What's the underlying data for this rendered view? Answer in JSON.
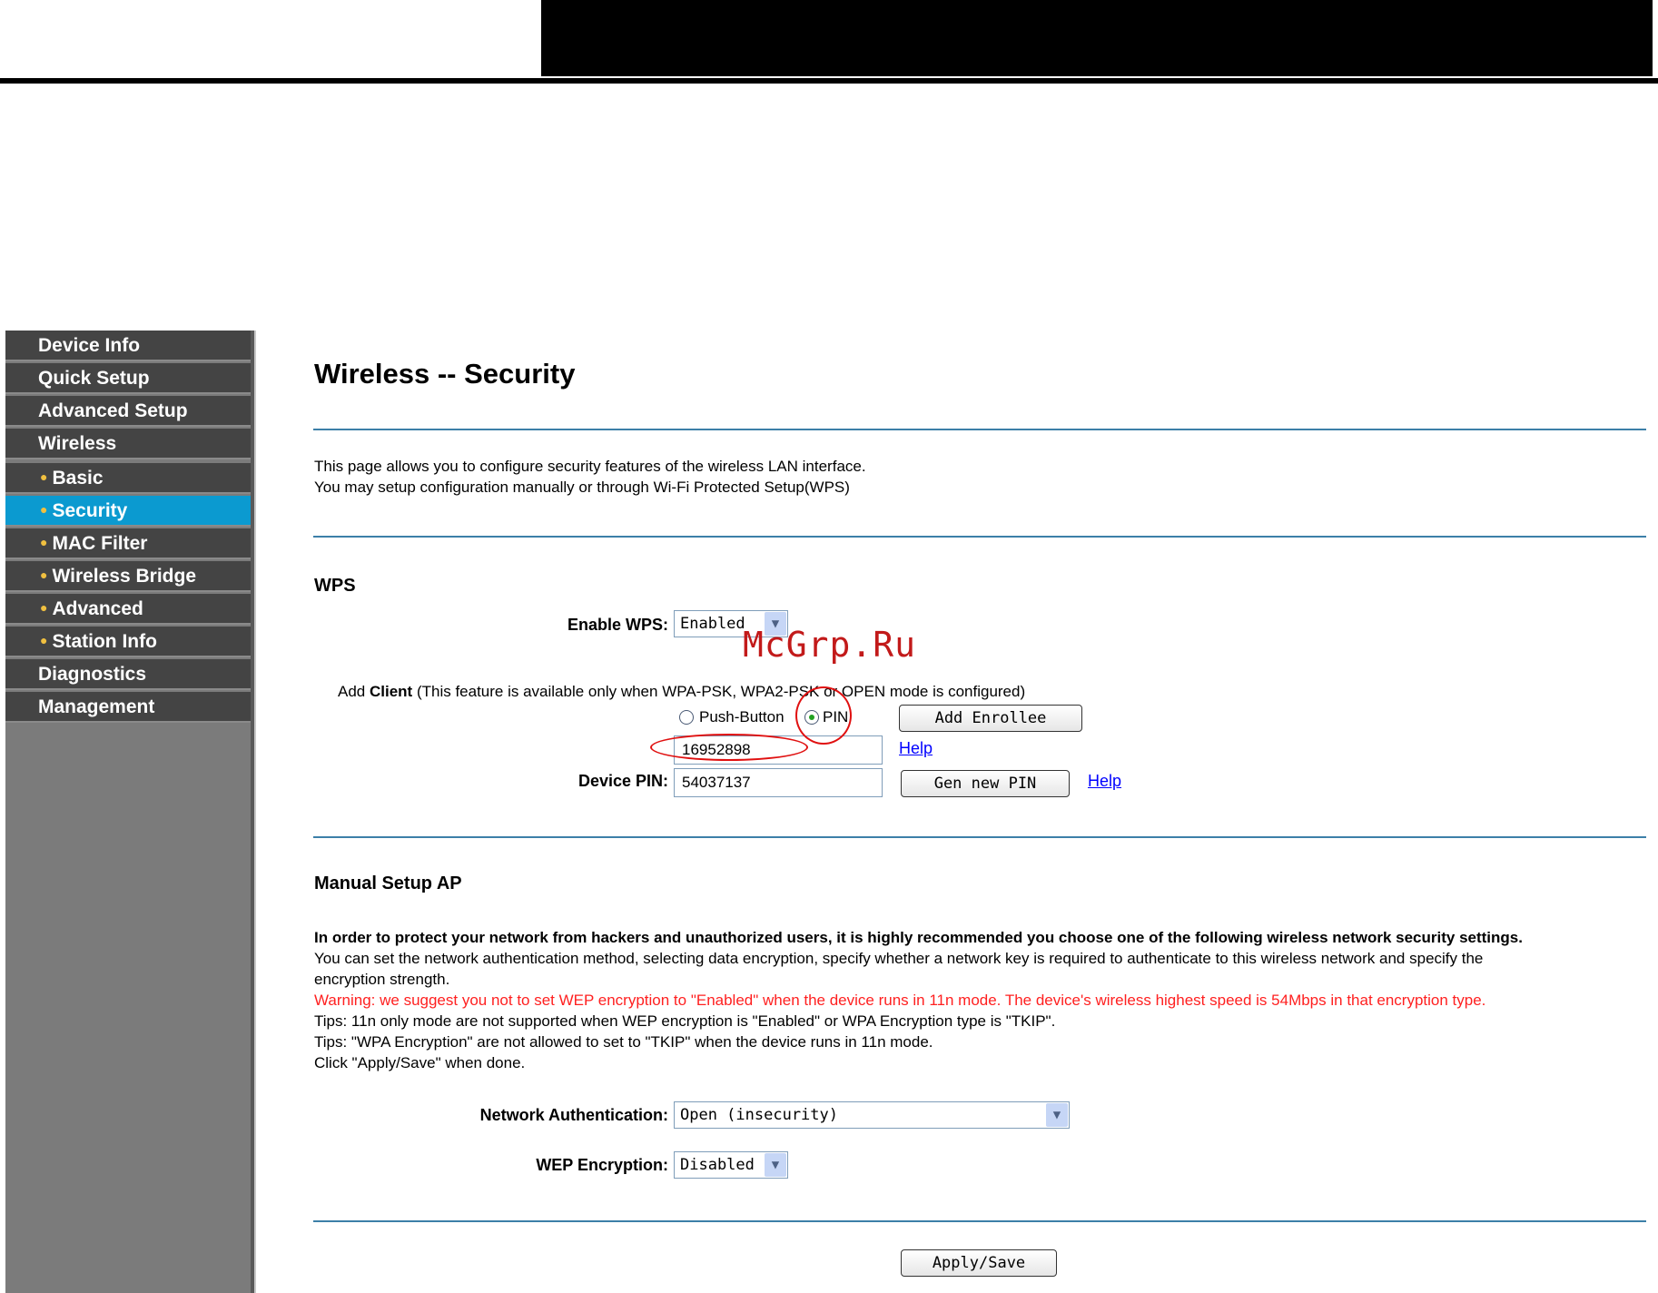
{
  "sidebar": {
    "items": [
      {
        "label": "Device Info"
      },
      {
        "label": "Quick Setup"
      },
      {
        "label": "Advanced Setup"
      },
      {
        "label": "Wireless"
      },
      {
        "label": "Basic"
      },
      {
        "label": "Security"
      },
      {
        "label": "MAC Filter"
      },
      {
        "label": "Wireless Bridge"
      },
      {
        "label": "Advanced"
      },
      {
        "label": "Station Info"
      },
      {
        "label": "Diagnostics"
      },
      {
        "label": "Management"
      }
    ],
    "active_item": "Security"
  },
  "page": {
    "title": "Wireless -- Security",
    "intro_line1": "This page allows you to configure security features of the wireless LAN interface.",
    "intro_line2": "You may setup configuration manually or through Wi-Fi Protected Setup(WPS)"
  },
  "wps": {
    "heading": "WPS",
    "enable_label": "Enable WPS:",
    "enable_value": "Enabled",
    "add_client_prefix": "Add ",
    "add_client_bold": "Client",
    "add_client_note": " (This feature is available only when WPA-PSK, WPA2-PSK or OPEN mode is configured)",
    "push_button_label": "Push-Button",
    "pin_label": "PIN",
    "selected_method": "PIN",
    "add_enrollee_label": "Add Enrollee",
    "enrollee_pin_value": "16952898",
    "help_label": "Help",
    "device_pin_label": "Device PIN:",
    "device_pin_value": "54037137",
    "gen_pin_label": "Gen new PIN",
    "help2_label": "Help"
  },
  "manual": {
    "heading": "Manual Setup AP",
    "bold_line": "In order to protect your network from hackers and unauthorized users, it is highly recommended you choose one of the following wireless network security settings.",
    "line2": "You can set the network authentication method, selecting data encryption, specify whether a network key is required to authenticate to this wireless network and specify the",
    "line3": "encryption strength.",
    "warning": "Warning: we suggest you not to set WEP encryption to \"Enabled\" when the device runs in 11n mode. The device's wireless highest speed is 54Mbps in that encryption type.",
    "tip1": "Tips: 11n only mode are not supported when WEP encryption is \"Enabled\" or WPA Encryption type is \"TKIP\".",
    "tip2": "Tips: \"WPA Encryption\" are not allowed to set to \"TKIP\" when the device runs in 11n mode.",
    "click_note": "Click \"Apply/Save\" when done.",
    "auth_label": "Network Authentication:",
    "auth_value": "Open (insecurity)",
    "wep_label": "WEP Encryption:",
    "wep_value": "Disabled",
    "apply_label": "Apply/Save"
  },
  "watermark": "McGrp.Ru",
  "colors": {
    "sidebar_bg": "#444444",
    "active_item": "#0b9ad0",
    "divider": "#3c7fa8",
    "warning": "#ff2020",
    "annotation": "#e01010"
  }
}
